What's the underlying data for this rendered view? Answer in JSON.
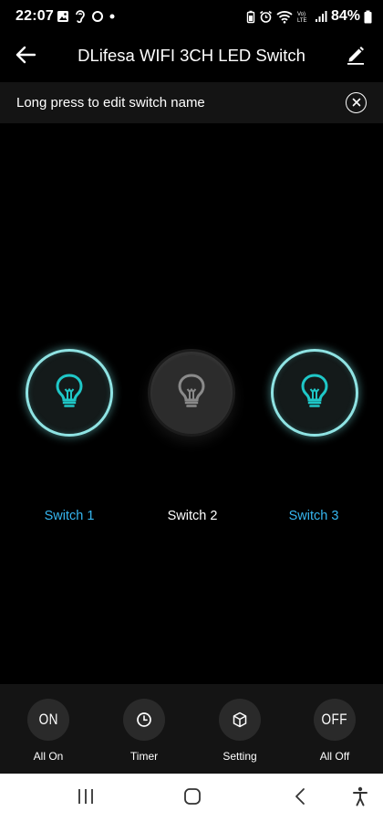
{
  "status_bar": {
    "time": "22:07",
    "battery_percent": "84%",
    "network_label": "Vo) LTE"
  },
  "header": {
    "title": "DLifesa WIFI 3CH LED Switch",
    "back_icon": "arrow-left-icon",
    "edit_icon": "pencil-icon"
  },
  "hint": {
    "text": "Long press to edit switch name",
    "close_icon": "close-circle-icon"
  },
  "switches": [
    {
      "label": "Switch 1",
      "state": "on",
      "icon": "lightbulb-icon"
    },
    {
      "label": "Switch 2",
      "state": "off",
      "icon": "lightbulb-icon"
    },
    {
      "label": "Switch 3",
      "state": "on",
      "icon": "lightbulb-icon"
    }
  ],
  "actions": {
    "all_on": {
      "label": "All On",
      "icon_text": "ON"
    },
    "timer": {
      "label": "Timer",
      "icon": "clock-icon"
    },
    "setting": {
      "label": "Setting",
      "icon": "cube-icon"
    },
    "all_off": {
      "label": "All Off",
      "icon_text": "OFF"
    }
  },
  "colors": {
    "background": "#000000",
    "panel": "#141414",
    "accent_on_ring": "#8fe3e3",
    "accent_on_bulb": "#1fc7c7",
    "label_on": "#36b6f0",
    "bulb_off": "#8a8a8a"
  },
  "nav": {
    "recent_icon": "recent-apps-icon",
    "home_icon": "home-icon",
    "back_icon": "nav-back-icon",
    "accessibility_icon": "accessibility-icon"
  }
}
